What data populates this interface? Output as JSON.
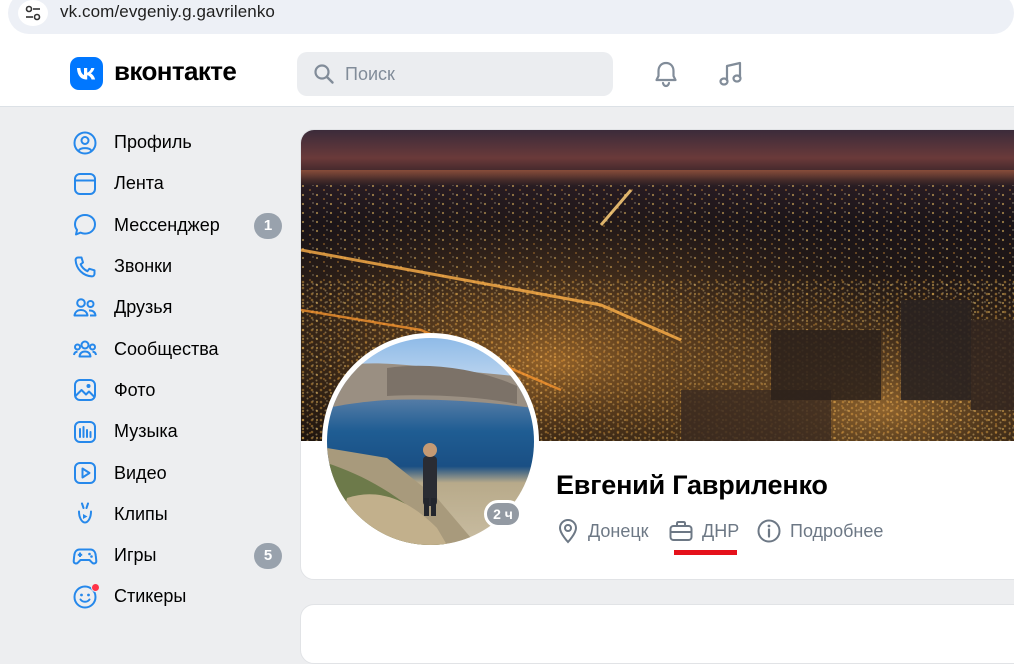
{
  "browser": {
    "url": "vk.com/evgeniy.g.gavrilenko"
  },
  "header": {
    "brand": "вконтакте",
    "search_placeholder": "Поиск"
  },
  "sidebar": {
    "items": [
      {
        "label": "Профиль",
        "icon": "profile-icon"
      },
      {
        "label": "Лента",
        "icon": "feed-icon"
      },
      {
        "label": "Мессенджер",
        "icon": "messenger-icon",
        "badge": "1"
      },
      {
        "label": "Звонки",
        "icon": "phone-icon"
      },
      {
        "label": "Друзья",
        "icon": "friends-icon"
      },
      {
        "label": "Сообщества",
        "icon": "communities-icon"
      },
      {
        "label": "Фото",
        "icon": "photo-icon"
      },
      {
        "label": "Музыка",
        "icon": "music-icon"
      },
      {
        "label": "Видео",
        "icon": "video-icon"
      },
      {
        "label": "Клипы",
        "icon": "clips-icon"
      },
      {
        "label": "Игры",
        "icon": "games-icon",
        "badge": "5"
      },
      {
        "label": "Стикеры",
        "icon": "stickers-icon"
      }
    ]
  },
  "profile": {
    "name": "Евгений Гавриленко",
    "last_seen": "2 ч",
    "city": "Донецк",
    "work": "ДНР",
    "more": "Подробнее"
  },
  "colors": {
    "accent": "#0077ff",
    "icon": "#2688eb",
    "badge": "#99a2ad",
    "underline": "#e5111b",
    "notification_dot": "#ff3347"
  }
}
